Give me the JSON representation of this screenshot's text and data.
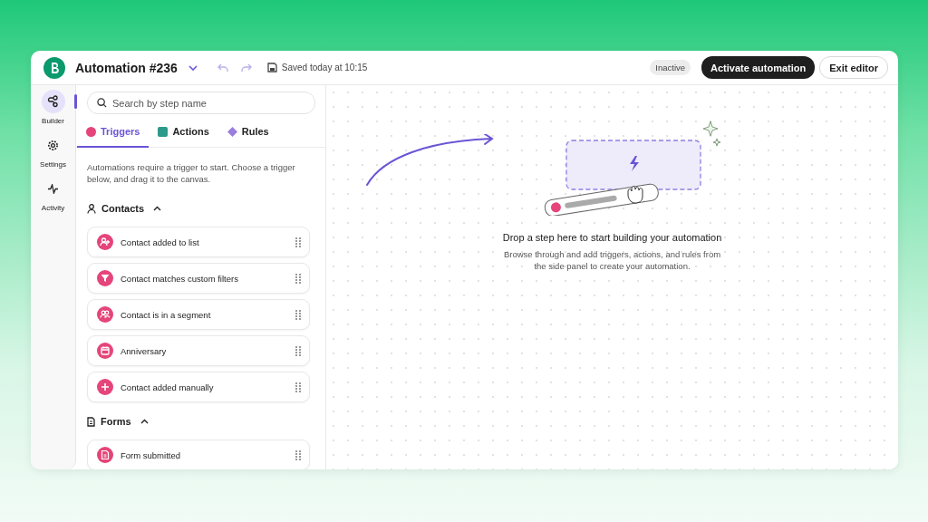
{
  "header": {
    "title": "Automation #236",
    "saved": "Saved today at 10:15",
    "status": "Inactive",
    "activate_button": "Activate automation",
    "exit_button": "Exit editor"
  },
  "rail": [
    {
      "label": "Builder",
      "kind": "builder",
      "selected": true
    },
    {
      "label": "Settings",
      "kind": "settings",
      "selected": false
    },
    {
      "label": "Activity",
      "kind": "activity",
      "selected": false
    }
  ],
  "search": {
    "placeholder": "Search by step name"
  },
  "tabs": [
    {
      "label": "Triggers",
      "kind": "circle",
      "color": "#e5457a",
      "selected": true
    },
    {
      "label": "Actions",
      "kind": "square",
      "color": "#2b9a8a",
      "selected": false
    },
    {
      "label": "Rules",
      "kind": "diamond",
      "color": "#9b7de0",
      "selected": false
    }
  ],
  "intro": "Automations require a trigger to start. Choose a trigger below, and drag it to the canvas.",
  "sections": [
    {
      "title": "Contacts",
      "kind": "person",
      "expanded": true,
      "items": [
        {
          "label": "Contact added to list",
          "kind": "user-plus"
        },
        {
          "label": "Contact matches custom filters",
          "kind": "filter"
        },
        {
          "label": "Contact is in a segment",
          "kind": "users"
        },
        {
          "label": "Anniversary",
          "kind": "calendar"
        },
        {
          "label": "Contact added manually",
          "kind": "plus"
        }
      ]
    },
    {
      "title": "Forms",
      "kind": "document",
      "expanded": true,
      "items": [
        {
          "label": "Form submitted",
          "kind": "form"
        }
      ]
    }
  ],
  "canvas": {
    "title": "Drop a step here to start building your automation",
    "description": "Browse through and add triggers, actions, and rules from the side panel to create your automation."
  }
}
